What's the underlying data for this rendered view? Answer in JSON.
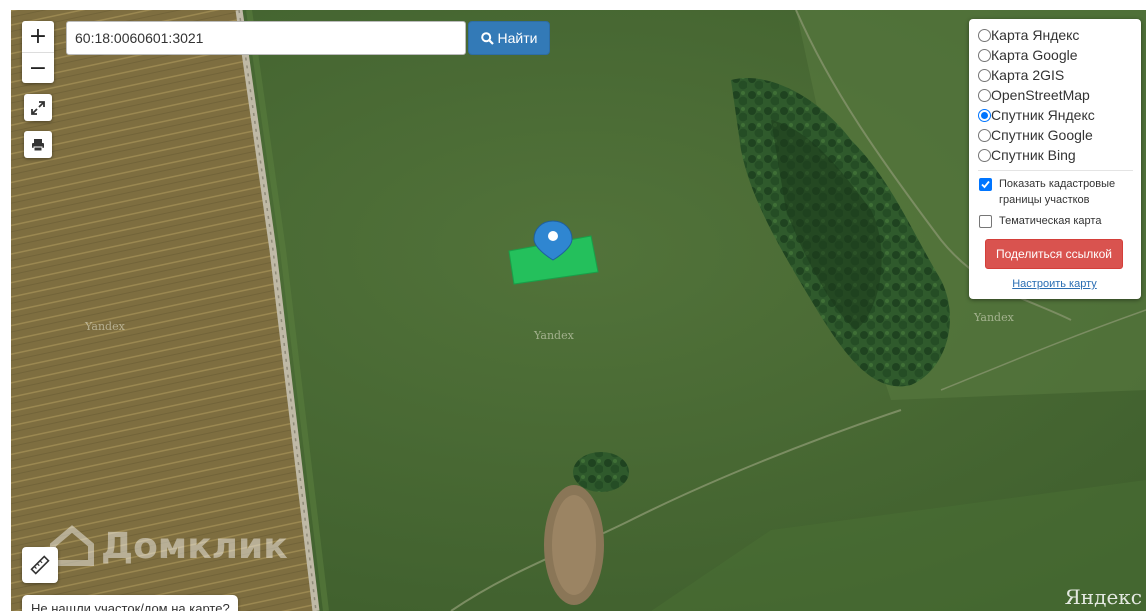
{
  "search": {
    "value": "60:18:0060601:3021",
    "button_label": "Найти"
  },
  "zoom": {
    "in_label": "+",
    "out_label": "−"
  },
  "layers": [
    {
      "label": "Карта Яндекс",
      "selected": false
    },
    {
      "label": "Карта Google",
      "selected": false
    },
    {
      "label": "Карта 2GIS",
      "selected": false
    },
    {
      "label": "OpenStreetMap",
      "selected": false
    },
    {
      "label": "Спутник Яндекс",
      "selected": true
    },
    {
      "label": "Спутник Google",
      "selected": false
    },
    {
      "label": "Спутник Bing",
      "selected": false
    }
  ],
  "options": {
    "cadastral_label": "Показать кадастровые границы участков",
    "cadastral_checked": true,
    "thematic_label": "Тематическая карта",
    "thematic_checked": false
  },
  "share_button": "Поделиться ссылкой",
  "config_link": "Настроить карту",
  "not_found": "Не нашли участок/дом на карте?",
  "watermarks": {
    "yandex_small": "Yandex",
    "brand": "Домклик",
    "logo": "Яндекс"
  },
  "icons": {
    "fullscreen": "expand-icon",
    "print": "printer-icon",
    "search": "search-icon",
    "marker": "map-marker-icon",
    "ruler": "ruler-icon"
  },
  "colors": {
    "parcel": "#22c55e",
    "marker": "#2f86d1",
    "search_button": "#337ab7",
    "share_button": "#d9534f",
    "link": "#2a6eb3"
  }
}
